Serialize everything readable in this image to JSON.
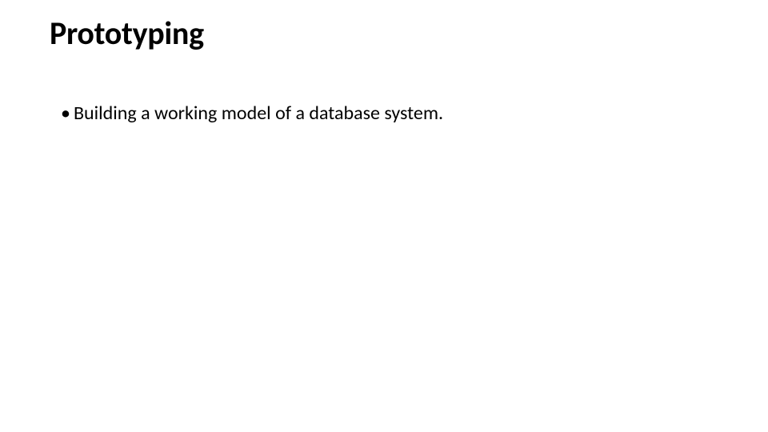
{
  "slide": {
    "title": "Prototyping",
    "bullets": [
      "Building a working model of a database system."
    ]
  }
}
